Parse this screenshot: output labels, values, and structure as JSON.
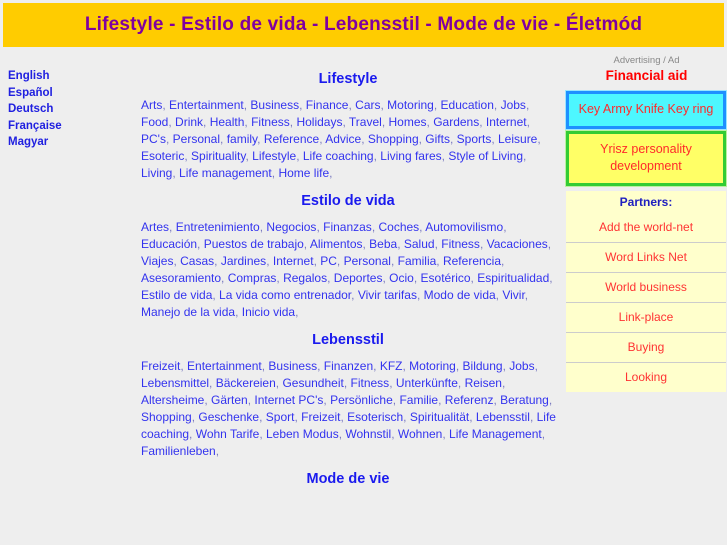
{
  "banner": {
    "title": "Lifestyle - Estilo de vida - Lebensstil - Mode de vie - Életmód",
    "background_color": "#ffcc00",
    "text_color": "#8000a0"
  },
  "languages": [
    {
      "label": "English"
    },
    {
      "label": "Español"
    },
    {
      "label": "Deutsch"
    },
    {
      "label": "Française"
    },
    {
      "label": "Magyar"
    }
  ],
  "sections": [
    {
      "title": "Lifestyle",
      "keywords": [
        "Arts",
        "Entertainment",
        "Business",
        "Finance",
        "Cars",
        "Motoring",
        "Education",
        "Jobs",
        "Food",
        "Drink",
        "Health",
        "Fitness",
        "Holidays",
        "Travel",
        "Homes",
        "Gardens",
        "Internet",
        "PC's",
        "Personal",
        "family",
        "Reference",
        "Advice",
        "Shopping",
        "Gifts",
        "Sports",
        "Leisure",
        "Esoteric",
        "Spirituality",
        "Lifestyle",
        "Life coaching",
        "Living fares",
        "Style of Living",
        "Living",
        "Life management",
        "Home life"
      ]
    },
    {
      "title": "Estilo de vida",
      "keywords": [
        "Artes",
        "Entretenimiento",
        "Negocios",
        "Finanzas",
        "Coches",
        "Automovilismo",
        "Educación",
        "Puestos de trabajo",
        "Alimentos",
        "Beba",
        "Salud",
        "Fitness",
        "Vacaciones",
        "Viajes",
        "Casas",
        "Jardines",
        "Internet",
        "PC",
        "Personal",
        "Familia",
        "Referencia",
        "Asesoramiento",
        "Compras",
        "Regalos",
        "Deportes",
        "Ocio",
        "Esotérico",
        "Espiritualidad",
        "Estilo de vida",
        "La vida como entrenador",
        "Vivir tarifas",
        "Modo de vida",
        "Vivir",
        "Manejo de la vida",
        "Inicio vida"
      ]
    },
    {
      "title": "Lebensstil",
      "keywords": [
        "Freizeit",
        "Entertainment",
        "Business",
        "Finanzen",
        "KFZ",
        "Motoring",
        "Bildung",
        "Jobs",
        "Lebensmittel",
        "Bäckereien",
        "Gesundheit",
        "Fitness",
        "Unterkünfte",
        "Reisen",
        "Altersheime",
        "Gärten",
        "Internet PC's",
        "Persönliche",
        "Familie",
        "Referenz",
        "Beratung",
        "Shopping",
        "Geschenke",
        "Sport",
        "Freizeit",
        "Esoterisch",
        "Spiritualität",
        "Lebensstil",
        "Life coaching",
        "Wohn Tarife",
        "Leben Modus",
        "Wohnstil",
        "Wohnen",
        "Life Management",
        "Familienleben"
      ]
    },
    {
      "title": "Mode de vie",
      "keywords": []
    }
  ],
  "advertising": {
    "label": "Advertising / Ad",
    "title": "Financial aid",
    "title_color": "#ff0000",
    "boxes": [
      {
        "text": "Key Army Knife Key ring",
        "style": "cyan"
      },
      {
        "text": "Yrisz personality development",
        "style": "yellow"
      }
    ]
  },
  "partners": {
    "heading": "Partners:",
    "items": [
      {
        "label": "Add the world-net"
      },
      {
        "label": "Word Links Net"
      },
      {
        "label": "World business"
      },
      {
        "label": "Link-place"
      },
      {
        "label": "Buying"
      },
      {
        "label": "Looking"
      }
    ]
  }
}
